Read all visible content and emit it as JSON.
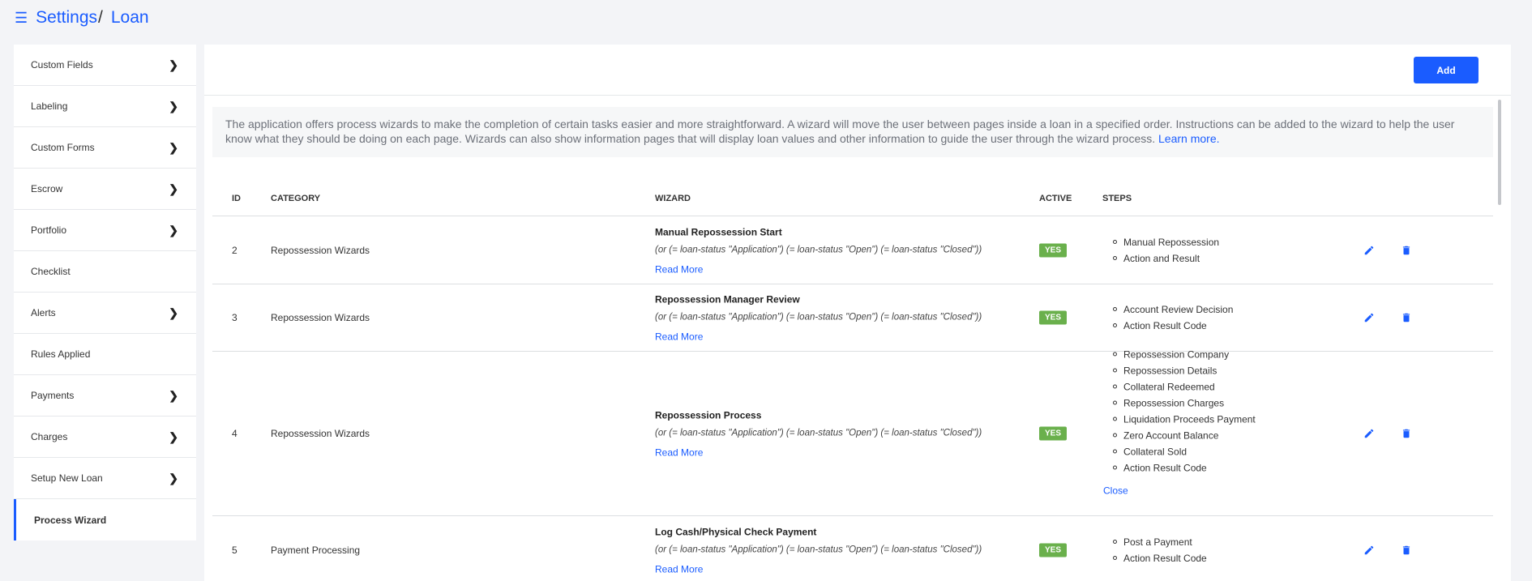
{
  "breadcrumb": {
    "root": "Settings",
    "separator": "/",
    "current": "Loan"
  },
  "sidebar": {
    "items": [
      {
        "label": "Custom Fields",
        "chevron": true
      },
      {
        "label": "Labeling",
        "chevron": true
      },
      {
        "label": "Custom Forms",
        "chevron": true
      },
      {
        "label": "Escrow",
        "chevron": true
      },
      {
        "label": "Portfolio",
        "chevron": true
      },
      {
        "label": "Checklist",
        "chevron": false
      },
      {
        "label": "Alerts",
        "chevron": true
      },
      {
        "label": "Rules Applied",
        "chevron": false
      },
      {
        "label": "Payments",
        "chevron": true
      },
      {
        "label": "Charges",
        "chevron": true
      },
      {
        "label": "Setup New Loan",
        "chevron": true
      },
      {
        "label": "Process Wizard",
        "chevron": false,
        "active": true
      }
    ]
  },
  "toolbar": {
    "add_label": "Add"
  },
  "info": {
    "text": "The application offers process wizards to make the completion of certain tasks easier and more straightforward. A wizard will move the user between pages inside a loan in a specified order. Instructions can be added to the wizard to help the user know what they should be doing on each page. Wizards can also show information pages that will display loan values and other information to guide the user through the wizard process.",
    "link": "Learn more."
  },
  "table": {
    "headers": {
      "id": "ID",
      "category": "CATEGORY",
      "wizard": "WIZARD",
      "active": "ACTIVE",
      "steps": "STEPS"
    },
    "rows": [
      {
        "id": "2",
        "category": "Repossession Wizards",
        "title": "Manual Repossession Start",
        "formula": "(or (= loan-status \"Application\") (= loan-status \"Open\") (= loan-status \"Closed\"))",
        "read_more": "Read More",
        "active": "YES",
        "steps": [
          "Manual Repossession",
          "Action and Result"
        ]
      },
      {
        "id": "3",
        "category": "Repossession Wizards",
        "title": "Repossession Manager Review",
        "formula": "(or (= loan-status \"Application\") (= loan-status \"Open\") (= loan-status \"Closed\"))",
        "read_more": "Read More",
        "active": "YES",
        "steps": [
          "Account Review Decision",
          "Action Result Code"
        ]
      },
      {
        "id": "4",
        "category": "Repossession Wizards",
        "title": "Repossession Process",
        "formula": "(or (= loan-status \"Application\") (= loan-status \"Open\") (= loan-status \"Closed\"))",
        "read_more": "Read More",
        "active": "YES",
        "steps": [
          "Repossession Company",
          "Repossession Details",
          "Collateral Redeemed",
          "Repossession Charges",
          "Liquidation Proceeds Payment",
          "Zero Account Balance",
          "Collateral Sold",
          "Action Result Code"
        ],
        "close_label": "Close"
      },
      {
        "id": "5",
        "category": "Payment Processing",
        "title": "Log Cash/Physical Check Payment",
        "formula": "(or (= loan-status \"Application\") (= loan-status \"Open\") (= loan-status \"Closed\"))",
        "read_more": "Read More",
        "active": "YES",
        "steps": [
          "Post a Payment",
          "Action Result Code"
        ]
      }
    ]
  },
  "colors": {
    "accent": "#1a5cff",
    "active_badge": "#6ab04c",
    "background": "#f3f4f7"
  }
}
